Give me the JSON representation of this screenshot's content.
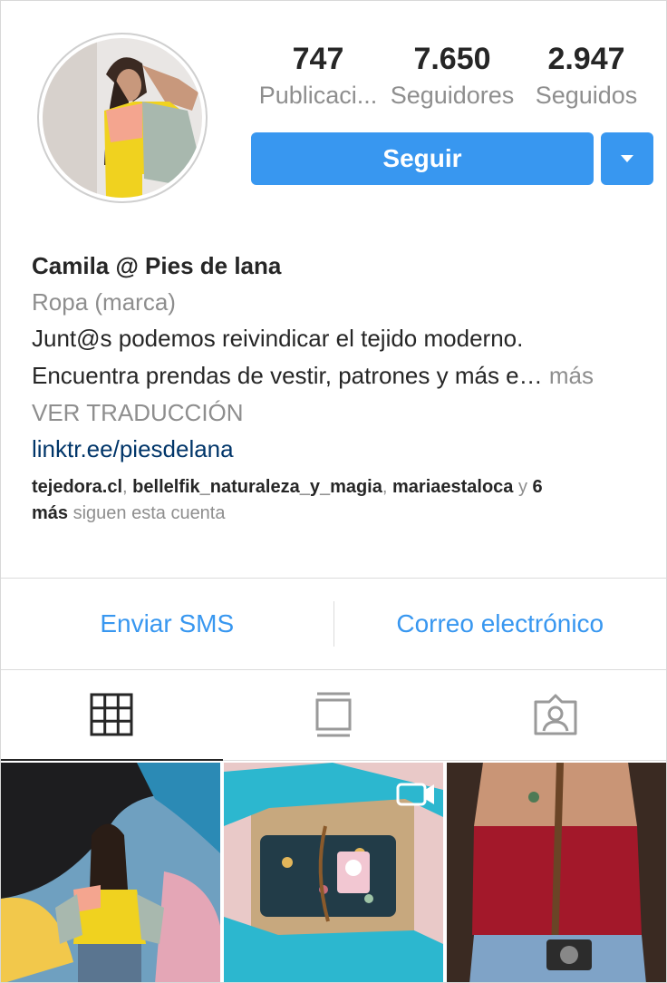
{
  "profile": {
    "avatar_alt": "profile-photo"
  },
  "stats": [
    {
      "number": "747",
      "label": "Publicaci..."
    },
    {
      "number": "7.650",
      "label": "Seguidores"
    },
    {
      "number": "2.947",
      "label": "Seguidos"
    }
  ],
  "actions": {
    "follow_label": "Seguir"
  },
  "bio": {
    "name": "Camila @ Pies de lana",
    "category": "Ropa (marca)",
    "line1": "Junt@s podemos reivindicar el tejido moderno.",
    "line2": "Encuentra prendas de vestir, patrones y más e…",
    "more": " más",
    "translate": "VER TRADUCCIÓN",
    "link": "linktr.ee/piesdelana"
  },
  "followed_by": {
    "user1": "tejedora.cl",
    "sep1": ", ",
    "user2": "bellelfik_naturaleza_y_magia",
    "sep2": ", ",
    "user3": "mariaestaloca",
    "and": " y ",
    "count": "6",
    "mas": "más",
    "suffix": " siguen esta cuenta"
  },
  "contact": {
    "sms_label": "Enviar SMS",
    "email_label": "Correo electrónico"
  },
  "tabs": [
    {
      "icon": "grid-icon"
    },
    {
      "icon": "feed-icon"
    },
    {
      "icon": "tagged-icon"
    }
  ],
  "colors": {
    "accent": "#3897f0",
    "link": "#003569",
    "muted": "#8e8e8e",
    "text": "#262626"
  }
}
